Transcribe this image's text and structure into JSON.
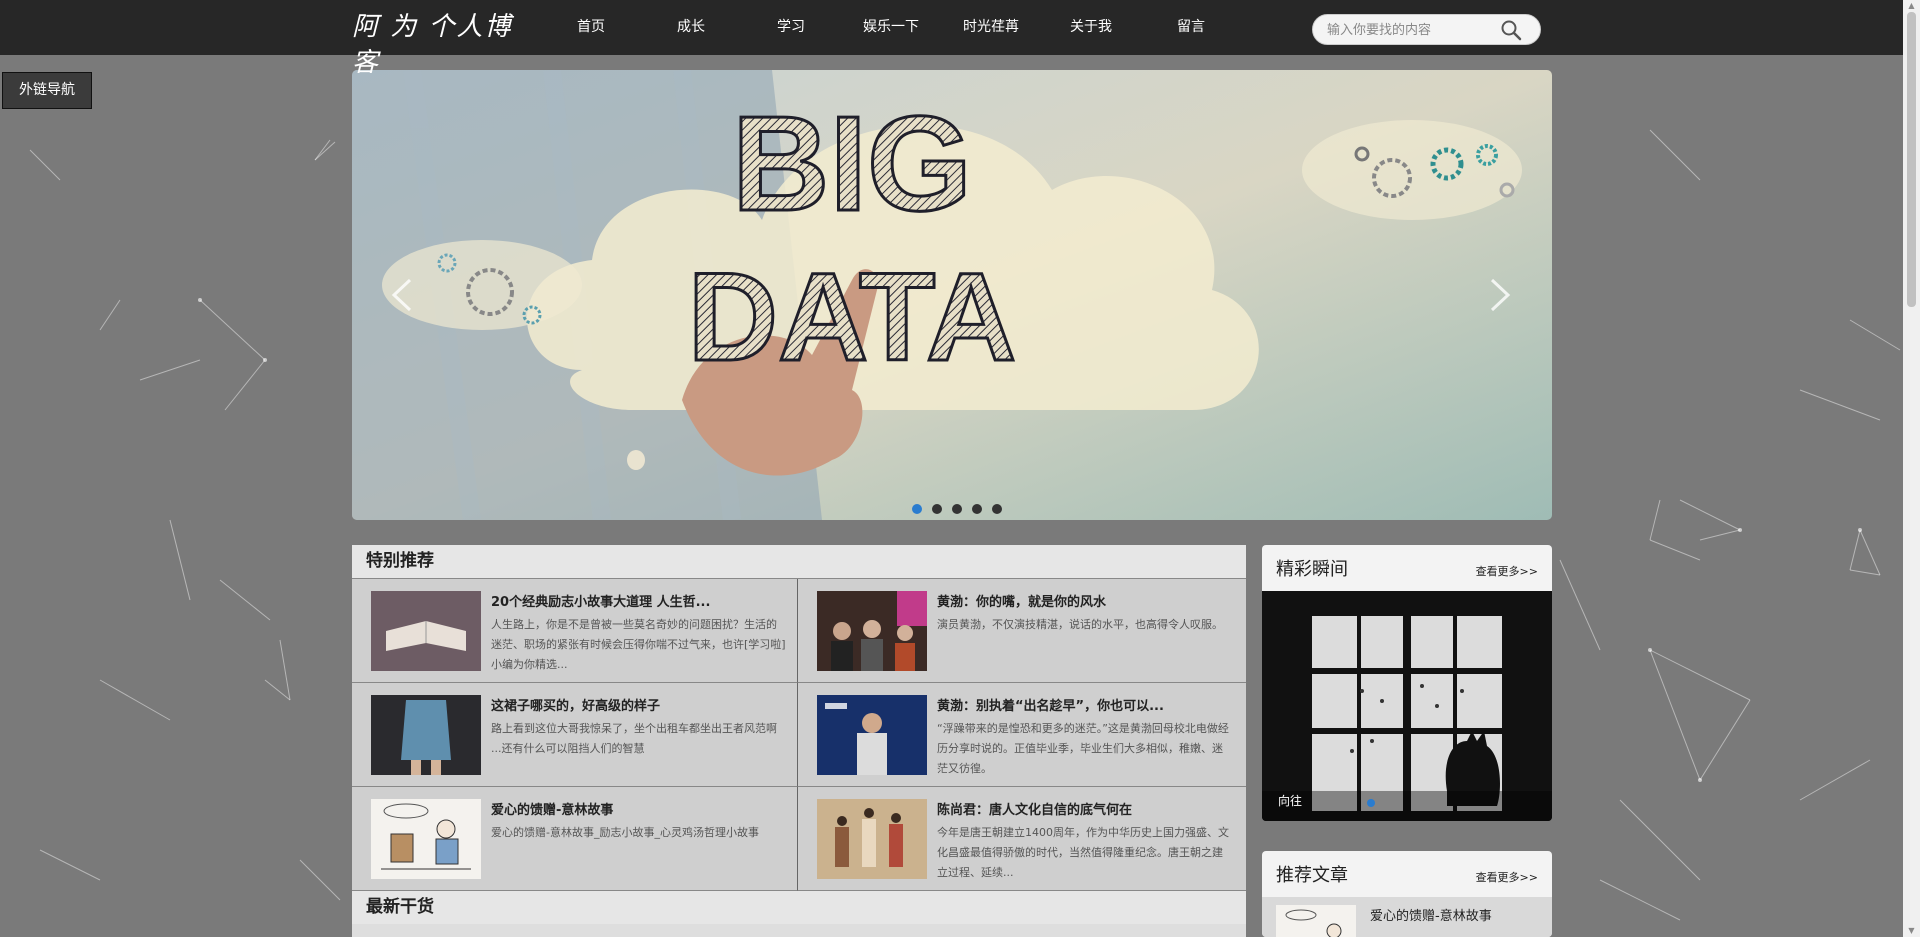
{
  "header": {
    "logo_text": "阿 为 个人博客",
    "nav": [
      "首页",
      "成长",
      "学习",
      "娱乐一下",
      "时光荏苒",
      "关于我",
      "留言"
    ],
    "search_placeholder": "输入你要找的内容"
  },
  "external_nav_label": "外链导航",
  "banner": {
    "headline_line1": "BIG",
    "headline_line2": "DATA",
    "slide_count": 5,
    "active_slide": 1
  },
  "featured": {
    "title": "特别推荐",
    "items": [
      {
        "title": "20个经典励志小故事大道理 人生哲...",
        "desc": "人生路上，你是不是曾被一些莫名奇妙的问题困扰？生活的迷茫、职场的紧张有时候会压得你喘不过气来，也许[学习啦]小编为你精选..."
      },
      {
        "title": "黄渤：你的嘴，就是你的风水",
        "desc": "演员黄渤，不仅演技精湛，说话的水平，也高得令人叹服。"
      },
      {
        "title": "这裙子哪买的，好高级的样子",
        "desc": "路上看到这位大哥我惊呆了，坐个出租车都坐出王者风范啊 ...还有什么可以阻挡人们的智慧"
      },
      {
        "title": "黄渤：别执着“出名趁早”，你也可以...",
        "desc": "“浮躁带来的是惶恐和更多的迷茫。”这是黄渤回母校北电做经历分享时说的。正值毕业季，毕业生们大多相似，稚嫩、迷茫又彷徨。"
      },
      {
        "title": "爱心的馈赠-意林故事",
        "desc": "爱心的馈赠-意林故事_励志小故事_心灵鸡汤哲理小故事"
      },
      {
        "title": "陈尚君：唐人文化自信的底气何在",
        "desc": "今年是唐王朝建立1400周年，作为中华历史上国力强盛、文化昌盛最值得骄傲的时代，当然值得隆重纪念。唐王朝之建立过程、延续..."
      }
    ]
  },
  "latest": {
    "title": "最新干货"
  },
  "moments": {
    "title": "精彩瞬间",
    "more": "查看更多>>",
    "caption": "向往"
  },
  "recommend": {
    "title": "推荐文章",
    "more": "查看更多>>",
    "items": [
      {
        "title": "爱心的馈赠-意林故事"
      }
    ]
  },
  "colors": {
    "topbar": "#272727",
    "accent_dot": "#2a7ccf",
    "page_bg": "#7a7a7a"
  }
}
